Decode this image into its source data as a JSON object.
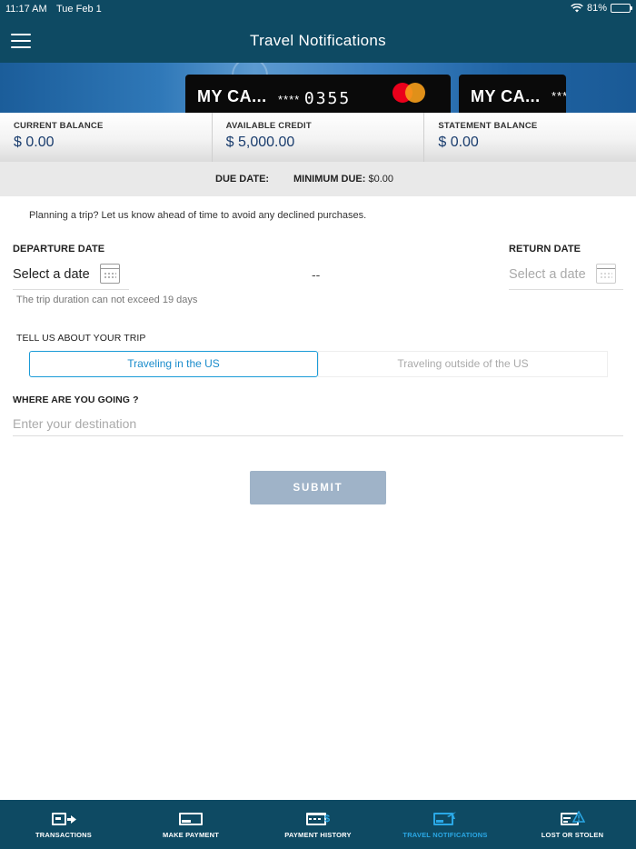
{
  "status_bar": {
    "time": "11:17 AM",
    "date": "Tue Feb 1",
    "battery": "81%",
    "battery_level": 0.81
  },
  "header": {
    "title": "Travel Notifications"
  },
  "cards": [
    {
      "name": "MY CA...",
      "masked": "****",
      "last4": "0355",
      "network": "mastercard"
    },
    {
      "name": "MY CA...",
      "masked": "***"
    }
  ],
  "balances": {
    "current_label": "CURRENT BALANCE",
    "current_value": "$ 0.00",
    "available_label": "AVAILABLE CREDIT",
    "available_value": "$ 5,000.00",
    "statement_label": "STATEMENT BALANCE",
    "statement_value": "$ 0.00"
  },
  "due": {
    "due_label": "DUE DATE:",
    "min_label": "MINIMUM DUE:",
    "min_value": "$0.00"
  },
  "form": {
    "intro": "Planning a trip? Let us know ahead of time to avoid any declined purchases.",
    "departure_label": "DEPARTURE DATE",
    "departure_value": "Select a date",
    "separator": "--",
    "return_label": "RETURN DATE",
    "return_value": "Select a date",
    "duration_hint": "The trip duration can not exceed 19 days",
    "trip_label": "TELL US ABOUT YOUR TRIP",
    "trip_options": [
      "Traveling in the US",
      "Traveling outside of the US"
    ],
    "trip_selected": "Traveling in the US",
    "destination_label": "WHERE ARE YOU GOING ?",
    "destination_placeholder": "Enter your destination",
    "destination_value": "",
    "submit_label": "SUBMIT"
  },
  "bottom_nav": {
    "items": [
      {
        "label": "TRANSACTIONS",
        "icon": "transactions-icon"
      },
      {
        "label": "MAKE PAYMENT",
        "icon": "card-payment-icon"
      },
      {
        "label": "PAYMENT HISTORY",
        "icon": "payment-history-icon"
      },
      {
        "label": "TRAVEL NOTIFICATIONS",
        "icon": "travel-card-icon"
      },
      {
        "label": "LOST OR STOLEN",
        "icon": "card-warning-icon"
      }
    ],
    "active": "TRAVEL NOTIFICATIONS"
  },
  "colors": {
    "header_bg": "#0e4a63",
    "accent": "#1a9bd7",
    "submit_disabled": "#9fb3c8",
    "balance_value": "#1a3d6e"
  }
}
